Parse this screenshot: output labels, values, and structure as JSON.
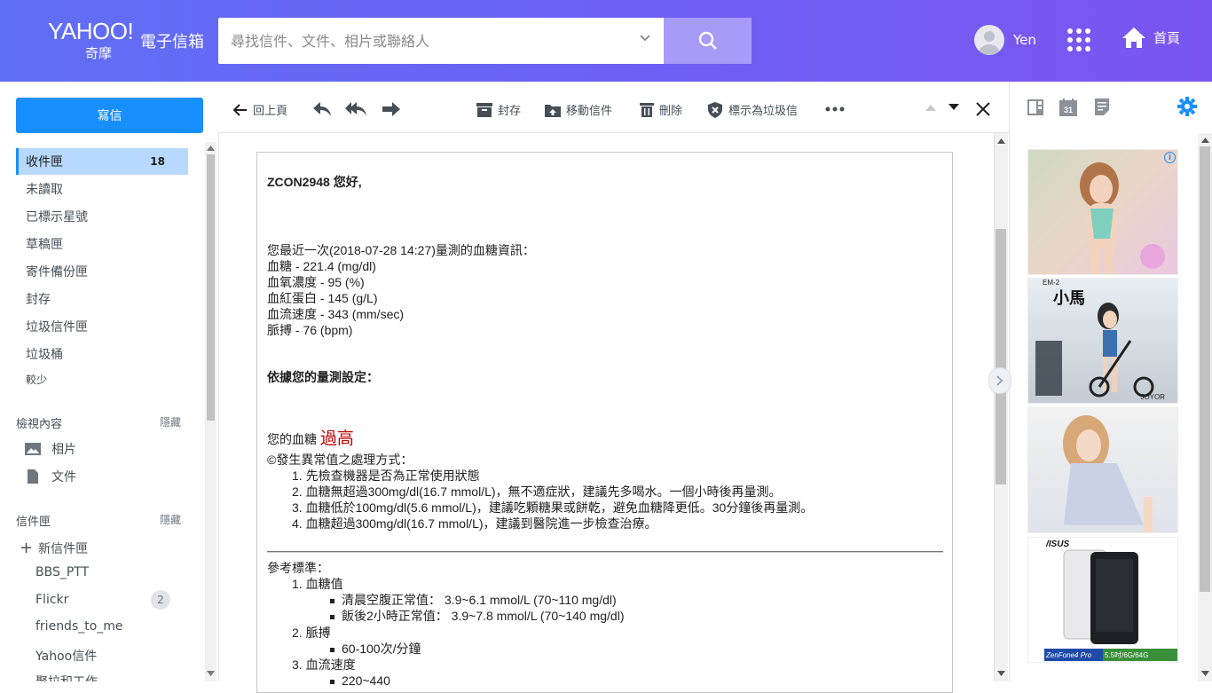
{
  "header": {
    "logo_yahoo": "YAHOO!",
    "logo_kimo": "奇摩",
    "logo_mail": "電子信箱",
    "search_placeholder": "尋找信件、文件、相片或聯絡人",
    "user_name": "Yen",
    "home_label": "首頁"
  },
  "sidebar": {
    "compose_label": "寫信",
    "folders": [
      {
        "label": "收件匣",
        "count": "18"
      },
      {
        "label": "未讀取"
      },
      {
        "label": "已標示星號"
      },
      {
        "label": "草稿匣"
      },
      {
        "label": "寄件備份匣"
      },
      {
        "label": "封存"
      },
      {
        "label": "垃圾信件匣"
      },
      {
        "label": "垃圾桶"
      }
    ],
    "less_label": "較少",
    "view_section": {
      "title": "檢視內容",
      "hide": "隱藏",
      "items": [
        "相片",
        "文件"
      ]
    },
    "folders_section": {
      "title": "信件匣",
      "hide": "隱藏",
      "new_folder": "新信件匣"
    },
    "user_folders": [
      {
        "label": "BBS_PTT"
      },
      {
        "label": "Flickr",
        "count": "2"
      },
      {
        "label": "friends_to_me"
      },
      {
        "label": "Yahoo信件"
      },
      {
        "label": "聚拉和工作"
      }
    ]
  },
  "toolbar": {
    "back_label": "回上頁",
    "archive_label": "封存",
    "move_label": "移動信件",
    "delete_label": "刪除",
    "spam_label": "標示為垃圾信"
  },
  "message": {
    "greeting": "ZCON2948 您好,",
    "intro": "您最近一次(2018-07-28 14:27)量測的血糖資訊：",
    "readings": [
      "血糖 - 221.4 (mg/dl)",
      "血氧濃度 - 95 (%)",
      "血紅蛋白 - 145 (g/L)",
      "血流速度 - 343 (mm/sec)",
      "脈搏 - 76 (bpm)"
    ],
    "settings_heading": "依據您的量測設定：",
    "result_prefix": "您的血糖",
    "result_value": "過高",
    "handling_title": "©發生異常值之處理方式：",
    "handling_steps": [
      "1. 先檢查機器是否為正常使用狀態",
      "2. 血糖無超過300mg/dl(16.7 mmol/L)，無不適症狀，建議先多喝水。一個小時後再量測。",
      "3. 血糖低於100mg/dl(5.6 mmol/L)，建議吃顆糖果或餅乾，避免血糖降更低。30分鐘後再量測。",
      "4. 血糖超過300mg/dl(16.7 mmol/L)，建議到醫院進一步檢查治療。"
    ],
    "reference_title": "參考標準：",
    "ref_1": "1. 血糖值",
    "ref_1_a": "清晨空腹正常值： 3.9~6.1 mmol/L (70~110 mg/dl)",
    "ref_1_b": "飯後2小時正常值： 3.9~7.8 mmol/L (70~140 mg/dl)",
    "ref_2": "2. 脈搏",
    "ref_2_a": "60-100次/分鐘",
    "ref_3": "3. 血流速度",
    "ref_3_a": "220~440"
  },
  "ads": {
    "ad2_model": "EM-2",
    "ad2_title": "小馬",
    "ad2_brand": "JOYOR",
    "ad4_brand": "/ISUS",
    "ad4_model": "ZenFone4 Pro",
    "ad4_spec": "5.5吋/6G/64G"
  },
  "colors": {
    "header_start": "#5f6ff5",
    "header_end": "#7a55f0",
    "accent": "#188fff",
    "alert_red": "#c00000"
  }
}
